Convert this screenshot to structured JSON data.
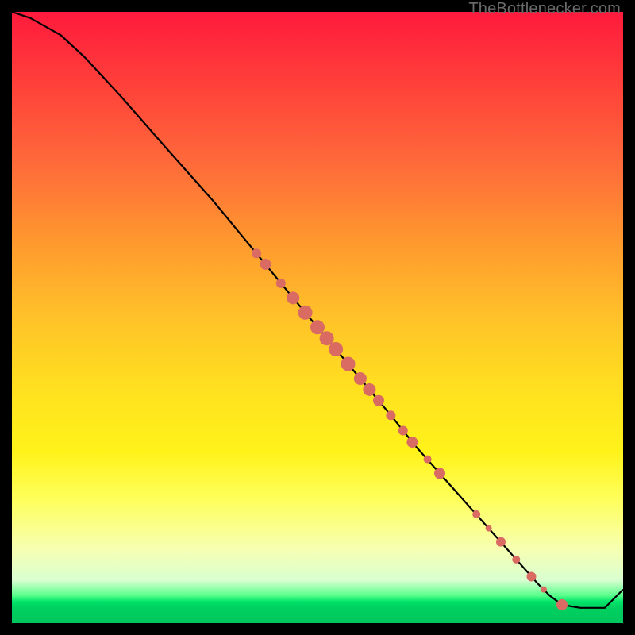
{
  "watermark": "TheBottlenecker.com",
  "colors": {
    "curve": "#000000",
    "dot_fill": "#d96b63",
    "dot_stroke": "#9c3f39"
  },
  "chart_data": {
    "type": "line",
    "title": "",
    "xlabel": "",
    "ylabel": "",
    "xlim": [
      0,
      100
    ],
    "ylim": [
      0,
      100
    ],
    "x": [
      0,
      3,
      8,
      12,
      18,
      25,
      33,
      40,
      47,
      52,
      57,
      62,
      66,
      70,
      74,
      78,
      82,
      86,
      88,
      90,
      93,
      97,
      100
    ],
    "values": [
      100,
      99.0,
      96.2,
      92.5,
      86.0,
      78.0,
      69.0,
      60.5,
      52.0,
      46.0,
      40.0,
      34.0,
      29.0,
      24.5,
      20.0,
      15.5,
      11.0,
      6.5,
      4.5,
      3.0,
      2.5,
      2.5,
      5.5
    ],
    "series": [
      {
        "name": "bottleneck-curve",
        "x": [
          0,
          3,
          8,
          12,
          18,
          25,
          33,
          40,
          47,
          52,
          57,
          62,
          66,
          70,
          74,
          78,
          82,
          86,
          88,
          90,
          93,
          97,
          100
        ],
        "y": [
          100,
          99.0,
          96.2,
          92.5,
          86.0,
          78.0,
          69.0,
          60.5,
          52.0,
          46.0,
          40.0,
          34.0,
          29.0,
          24.5,
          20.0,
          15.5,
          11.0,
          6.5,
          4.5,
          3.0,
          2.5,
          2.5,
          5.5
        ]
      }
    ],
    "markers": [
      {
        "x": 40,
        "y": 60.5,
        "r": 6
      },
      {
        "x": 41.5,
        "y": 58.7,
        "r": 7
      },
      {
        "x": 44,
        "y": 55.6,
        "r": 6
      },
      {
        "x": 46,
        "y": 53.2,
        "r": 8
      },
      {
        "x": 48,
        "y": 50.8,
        "r": 9
      },
      {
        "x": 50,
        "y": 48.4,
        "r": 9
      },
      {
        "x": 51.5,
        "y": 46.6,
        "r": 9
      },
      {
        "x": 53,
        "y": 44.8,
        "r": 9
      },
      {
        "x": 55,
        "y": 42.4,
        "r": 9
      },
      {
        "x": 57,
        "y": 40.0,
        "r": 8
      },
      {
        "x": 58.5,
        "y": 38.2,
        "r": 8
      },
      {
        "x": 60,
        "y": 36.4,
        "r": 7
      },
      {
        "x": 62,
        "y": 34.0,
        "r": 6
      },
      {
        "x": 64,
        "y": 31.5,
        "r": 6
      },
      {
        "x": 65.5,
        "y": 29.6,
        "r": 7
      },
      {
        "x": 68,
        "y": 26.8,
        "r": 5
      },
      {
        "x": 70,
        "y": 24.5,
        "r": 7
      },
      {
        "x": 76,
        "y": 17.8,
        "r": 5
      },
      {
        "x": 78,
        "y": 15.5,
        "r": 4
      },
      {
        "x": 80,
        "y": 13.3,
        "r": 6
      },
      {
        "x": 82.5,
        "y": 10.4,
        "r": 5
      },
      {
        "x": 85,
        "y": 7.6,
        "r": 6
      },
      {
        "x": 87,
        "y": 5.5,
        "r": 4
      },
      {
        "x": 90,
        "y": 3.0,
        "r": 7
      }
    ]
  }
}
